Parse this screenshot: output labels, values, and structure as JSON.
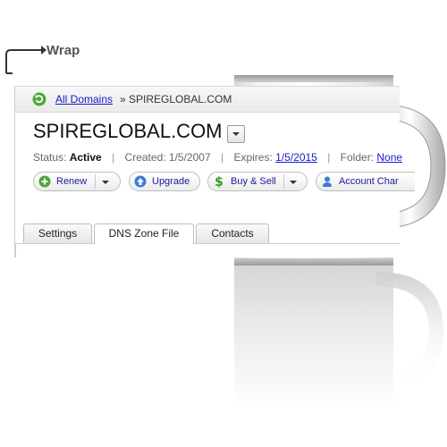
{
  "wrap_label": "Wrap",
  "breadcrumb": {
    "link": "All Domains",
    "separator": "»",
    "current": "SPIREGLOBAL.COM"
  },
  "domain": {
    "name": "SPIREGLOBAL.COM"
  },
  "status": {
    "status_label": "Status:",
    "status_value": "Active",
    "created_label": "Created: 1/5/2007",
    "expires_label": "Expires:",
    "expires_value": "1/5/2015",
    "folder_label": "Folder:",
    "folder_value": "None"
  },
  "actions": {
    "renew": "Renew",
    "upgrade": "Upgrade",
    "buy_sell": "Buy & Sell",
    "account_change": "Account Char"
  },
  "tabs": [
    {
      "label": "Settings"
    },
    {
      "label": "DNS Zone File"
    },
    {
      "label": "Contacts"
    }
  ],
  "icons": {
    "refresh": "refresh-icon",
    "renew": "plus-circle-icon",
    "upgrade": "up-arrow-circle-icon",
    "buy_sell": "dollar-icon",
    "account": "person-icon"
  },
  "colors": {
    "link": "#1a1ac8",
    "renew_green": "#3a9a2a",
    "upgrade_blue": "#2a6ac8"
  }
}
